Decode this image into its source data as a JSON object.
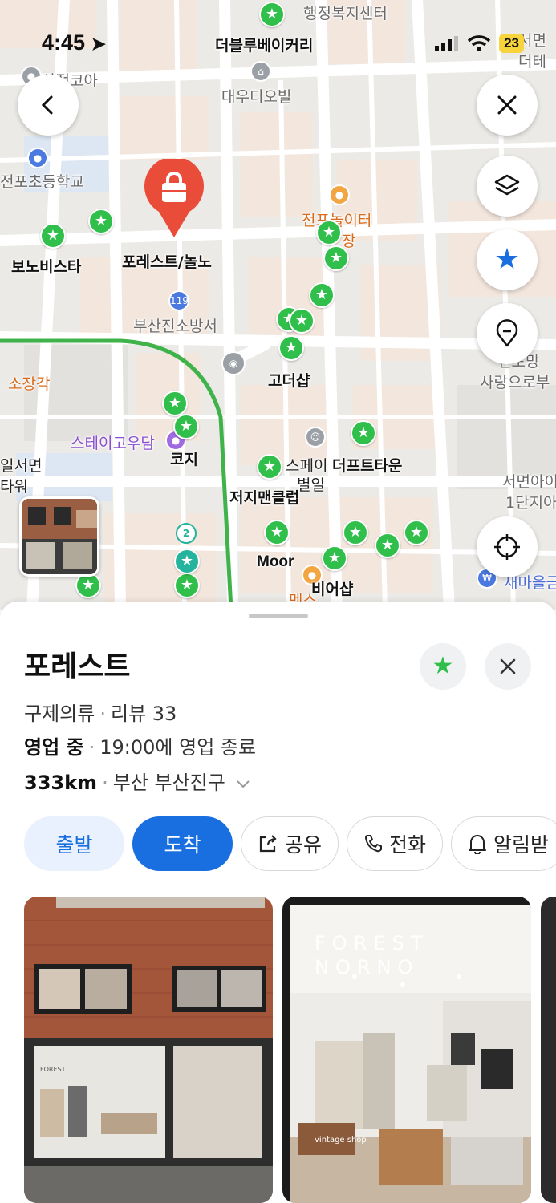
{
  "status_bar": {
    "time": "4:45",
    "battery": "23"
  },
  "map": {
    "labels": {
      "admin_center": "행정복지센터",
      "bakery": "더블루베이커리",
      "korea": "삼정코아",
      "daewoo": "대우디오빌",
      "school": "전포초등학교",
      "playground": "전포놀이터",
      "store": "장",
      "bonobista": "보노비스타",
      "forest_pin": "포레스트/놀노",
      "fire_station": "부산진소방서",
      "goddar": "고더샵",
      "sojang": "소장각",
      "stay": "스테이고우담",
      "kozy": "코지",
      "spei": "스페이",
      "byeolil": "별일",
      "deptown": "더프트타운",
      "jersey": "저지맨클럽",
      "moor": "Moor",
      "mensu": "멘스",
      "beershop": "비어샵",
      "seomyeon_tower_1": "일서면",
      "seomyeon_tower_2": "타워",
      "right_top_1": "서면",
      "right_top_2": "더테",
      "right_mid_1": "전포망",
      "right_mid_2": "사랑으로부",
      "right_low_1": "서면아이",
      "right_low_2": "1단지아",
      "samaeul": "새마을금",
      "cluster": "2"
    }
  },
  "place": {
    "name": "포레스트",
    "category": "구제의류",
    "reviews": "리뷰 33",
    "open_status": "영업 중",
    "hours": "19:00에 영업 종료",
    "distance": "333km",
    "region": "부산 부산진구"
  },
  "actions": {
    "depart": "출발",
    "arrive": "도착",
    "share": "공유",
    "call": "전화",
    "notify": "알림받"
  },
  "photos": {
    "sign_line1": "FOREST",
    "sign_line2": "NORNO",
    "vintage": "vintage shop"
  },
  "colors": {
    "accent": "#1a6fe0",
    "pin_green": "#2fbf4a",
    "pin_red": "#ea4c3a"
  }
}
